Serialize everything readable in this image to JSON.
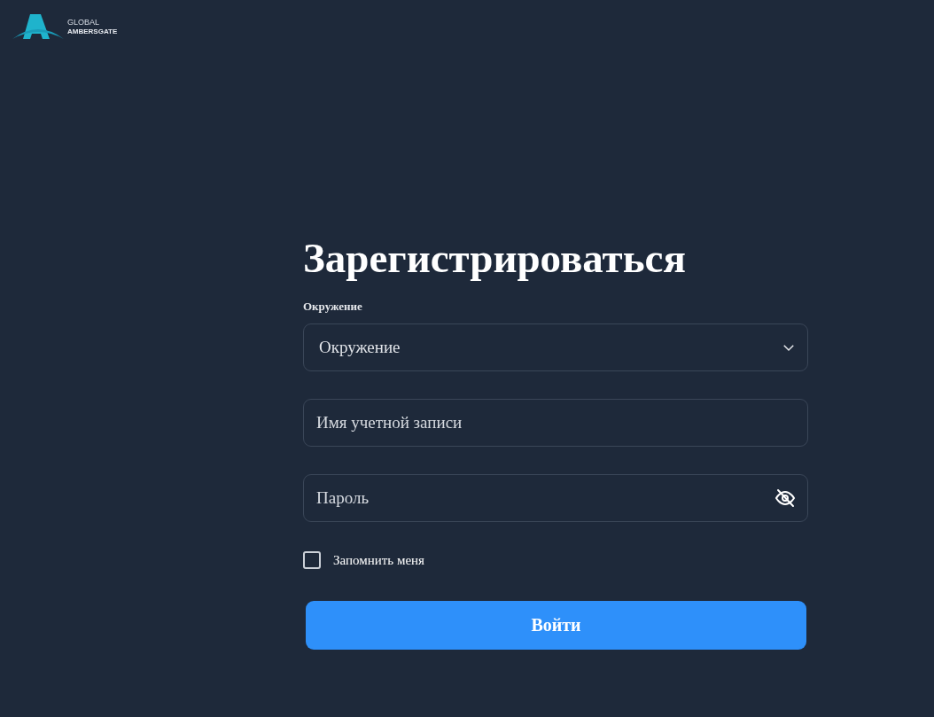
{
  "logo": {
    "line_1": "GLOBAL",
    "line_2": "AMBERSGATE"
  },
  "title": "Зарегистрироваться",
  "environment": {
    "label": "Окружение",
    "value": "Окружение"
  },
  "username": {
    "placeholder": "Имя учетной записи"
  },
  "password": {
    "placeholder": "Пароль"
  },
  "remember": {
    "label": "Запомнить меня",
    "checked": false
  },
  "submit": "Войти"
}
